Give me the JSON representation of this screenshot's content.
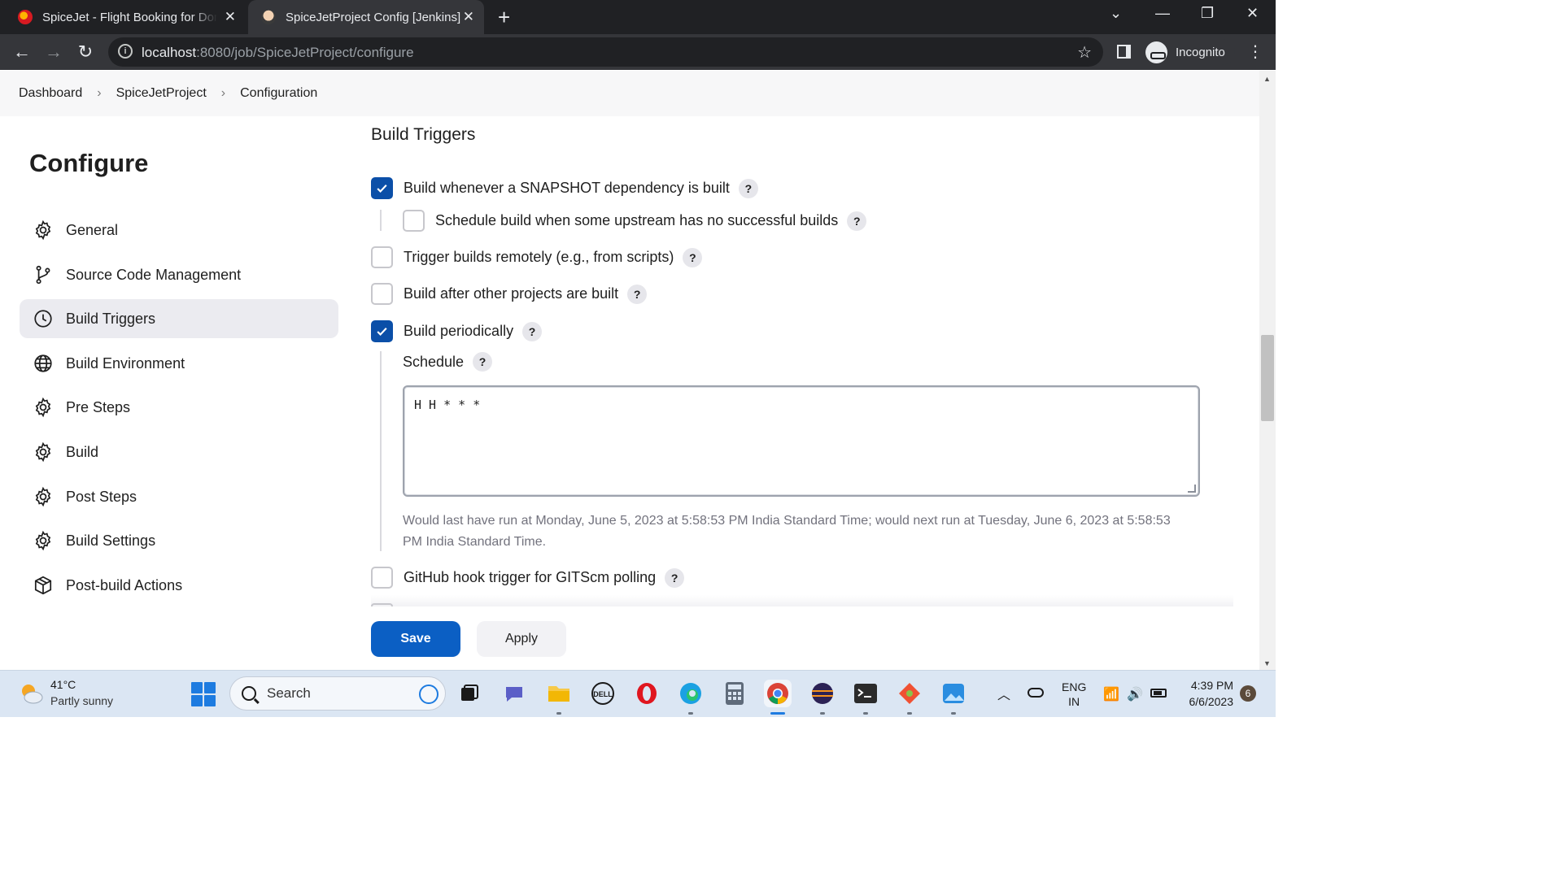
{
  "browser": {
    "tabs": [
      {
        "title": "SpiceJet - Flight Booking for Domestic and International",
        "favicon": "spicejet-logo-icon"
      },
      {
        "title": "SpiceJetProject Config [Jenkins]",
        "favicon": "jenkins-logo-icon"
      }
    ],
    "new_tab": "+",
    "url_host": "localhost",
    "url_path": ":8080/job/SpiceJetProject/configure",
    "profile_label": "Incognito"
  },
  "breadcrumb": [
    "Dashboard",
    "SpiceJetProject",
    "Configuration"
  ],
  "sidebar": {
    "title": "Configure",
    "items": [
      {
        "label": "General",
        "icon": "gear-icon",
        "active": false
      },
      {
        "label": "Source Code Management",
        "icon": "branch-icon",
        "active": false
      },
      {
        "label": "Build Triggers",
        "icon": "clock-icon",
        "active": true
      },
      {
        "label": "Build Environment",
        "icon": "globe-icon",
        "active": false
      },
      {
        "label": "Pre Steps",
        "icon": "gear-icon",
        "active": false
      },
      {
        "label": "Build",
        "icon": "gear-icon",
        "active": false
      },
      {
        "label": "Post Steps",
        "icon": "gear-icon",
        "active": false
      },
      {
        "label": "Build Settings",
        "icon": "gear-icon",
        "active": false
      },
      {
        "label": "Post-build Actions",
        "icon": "package-icon",
        "active": false
      }
    ]
  },
  "main": {
    "section_title": "Build Triggers",
    "triggers": [
      {
        "label": "Build whenever a SNAPSHOT dependency is built",
        "checked": true
      },
      {
        "label": "Schedule build when some upstream has no successful builds",
        "checked": false
      },
      {
        "label": "Trigger builds remotely (e.g., from scripts)",
        "checked": false
      },
      {
        "label": "Build after other projects are built",
        "checked": false
      },
      {
        "label": "Build periodically",
        "checked": true
      },
      {
        "label": "GitHub hook trigger for GITScm polling",
        "checked": false
      }
    ],
    "help_glyph": "?",
    "schedule_label": "Schedule",
    "schedule_value": "H H * * *",
    "schedule_info": "Would last have run at Monday, June 5, 2023 at 5:58:53 PM India Standard Time; would next run at Tuesday, June 6, 2023 at 5:58:53 PM India Standard Time."
  },
  "actions": {
    "save": "Save",
    "apply": "Apply"
  },
  "taskbar": {
    "weather_temp": "41°C",
    "weather_desc": "Partly sunny",
    "search_placeholder": "Search",
    "lang_line1": "ENG",
    "lang_line2": "IN",
    "time": "4:39 PM",
    "date": "6/6/2023",
    "notifications": "6"
  },
  "colors": {
    "accent": "#0b5fc4",
    "checkbox_checked": "#0b4fa8",
    "active_nav": "#ebebf0"
  }
}
